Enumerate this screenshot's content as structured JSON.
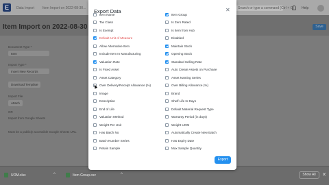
{
  "background": {
    "breadcrumbs": [
      "Data Import",
      "Item Import on 2022-08-30..."
    ],
    "search_text": "Search or type a command (Ctrl + G)",
    "help_label": "Help",
    "page_title": "Item Import on 2022-08-30 11:55",
    "side_button": "Save",
    "fields": {
      "doctype_label": "Document Type *",
      "doctype_value": "Item",
      "import_type_label": "Import Type *",
      "import_type_value": "Insert New Records",
      "template_button": "Download Template",
      "import_file_label": "Import File",
      "attach_button": "Attach",
      "or_label": "OR",
      "sheets_label": "Import from Google Sheets",
      "sheets_note": "Must be a publicly accessible Google Sheets URL"
    }
  },
  "downloads": {
    "items": [
      "UOM.xlsx",
      "Item Group.csv"
    ],
    "show_all": "Show All"
  },
  "modal": {
    "title": "Export Data",
    "export_button": "Export",
    "left_fields": [
      {
        "label": "Item Name",
        "checked": false
      },
      {
        "label": "Tax Class",
        "checked": false
      },
      {
        "label": "Is Exempt",
        "checked": false
      },
      {
        "label": "Default Unit of Measure",
        "checked": true,
        "highlight": true
      },
      {
        "label": "Allow Alternative Item",
        "checked": false
      },
      {
        "label": "Include Item In Manufacturing",
        "checked": false
      },
      {
        "label": "Valuation Rate",
        "checked": true
      },
      {
        "label": "Is Fixed Asset",
        "checked": false
      },
      {
        "label": "Asset Category",
        "checked": false
      },
      {
        "label": "Over Delivery/Receipt Allowance (%)",
        "checked": false
      },
      {
        "label": "Image",
        "checked": false
      },
      {
        "label": "Description",
        "checked": false
      },
      {
        "label": "End of Life",
        "checked": false
      },
      {
        "label": "Valuation Method",
        "checked": false
      },
      {
        "label": "Weight Per Unit",
        "checked": false
      },
      {
        "label": "Has Batch No",
        "checked": false
      },
      {
        "label": "Batch Number Series",
        "checked": false
      },
      {
        "label": "Retain Sample",
        "checked": false
      }
    ],
    "right_fields": [
      {
        "label": "Item Group",
        "checked": true
      },
      {
        "label": "Is Zero Rated",
        "checked": false
      },
      {
        "label": "Is Item from Hub",
        "checked": false
      },
      {
        "label": "Disabled",
        "checked": false
      },
      {
        "label": "Maintain Stock",
        "checked": true
      },
      {
        "label": "Opening Stock",
        "checked": true
      },
      {
        "label": "Standard Selling Rate",
        "checked": true
      },
      {
        "label": "Auto Create Assets on Purchase",
        "checked": false
      },
      {
        "label": "Asset Naming Series",
        "checked": false
      },
      {
        "label": "Over Billing Allowance (%)",
        "checked": false
      },
      {
        "label": "Brand",
        "checked": false
      },
      {
        "label": "Shelf Life In Days",
        "checked": false
      },
      {
        "label": "Default Material Request Type",
        "checked": false
      },
      {
        "label": "Warranty Period (in days)",
        "checked": false
      },
      {
        "label": "Weight UOM",
        "checked": false
      },
      {
        "label": "Automatically Create New Batch",
        "checked": false
      },
      {
        "label": "Has Expiry Date",
        "checked": false
      },
      {
        "label": "Max Sample Quantity",
        "checked": false
      }
    ]
  }
}
